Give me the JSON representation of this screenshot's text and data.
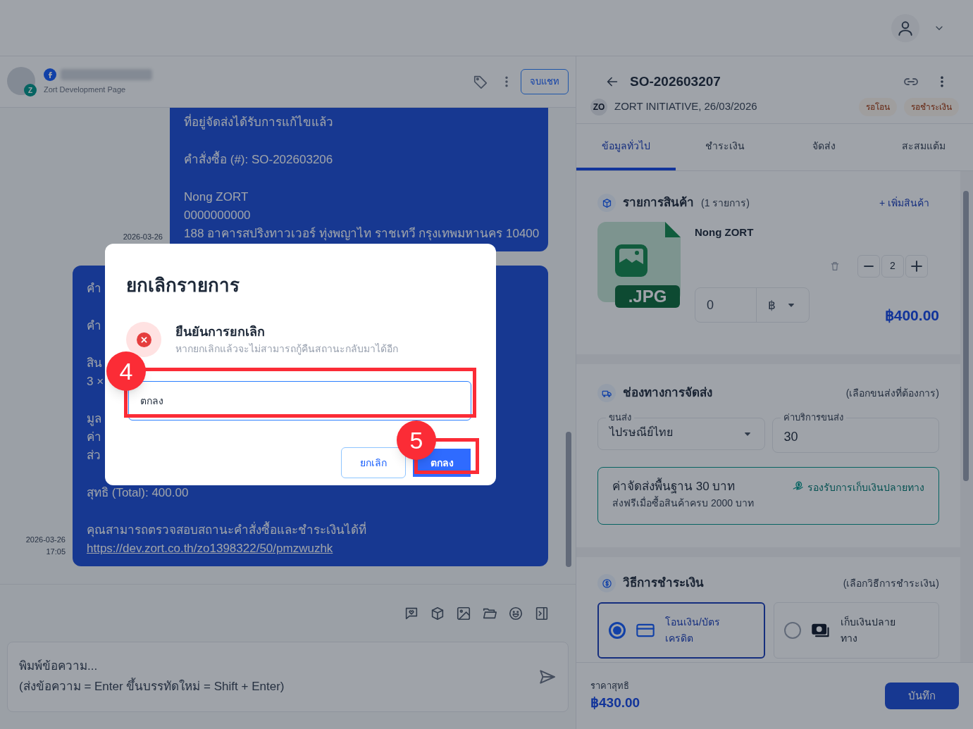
{
  "chat": {
    "header": {
      "page_name": "Zort Development Page",
      "avatar_badge": "Z",
      "end_button": "จบแชท"
    },
    "messages": [
      {
        "time": "2026-03-26",
        "paragraphs": [
          {
            "lines": [
              "ที่อยู่จัดส่งได้รับการแก้ไขแล้ว"
            ]
          },
          {
            "lines": [
              "คำสั่งซื้อ (#): SO-202603206"
            ]
          },
          {
            "lines": [
              "Nong ZORT",
              "0000000000",
              "188 อาคารสปริงทาวเวอร์ ทุ่งพญาไท ราชเทวี กรุงเทพมหานคร 10400"
            ]
          }
        ]
      },
      {
        "time": "2026-03-26 17:05",
        "paragraphs": [
          {
            "lines": [
              "คำ"
            ]
          },
          {
            "lines": [
              "คำ"
            ]
          },
          {
            "lines": [
              "สิน",
              "3 ×"
            ]
          },
          {
            "lines": [
              "มูล",
              "ค่า",
              "ส่ว"
            ]
          },
          {
            "lines": [
              "สุทธิ (Total): 400.00"
            ]
          },
          {
            "lines": [
              "คุณสามารถตรวจสอบสถานะคำสั่งซื้อและชำระเงินได้ที่"
            ],
            "link": "https://dev.zort.co.th/zo1398322/50/pmzwuzhk"
          }
        ]
      }
    ],
    "input": {
      "placeholder": "พิมพ์ข้อความ...\n(ส่งข้อความ = Enter ขึ้นบรรทัดใหม่ = Shift + Enter)"
    }
  },
  "order": {
    "number": "SO-202603207",
    "avatar": "ZO",
    "subtitle": "ZORT INITIATIVE, 26/03/2026",
    "badges": [
      "รอโอน",
      "รอชำระเงิน"
    ],
    "tabs": [
      {
        "label": "ข้อมูลทั่วไป",
        "selected": true
      },
      {
        "label": "ชำระเงิน",
        "selected": false
      },
      {
        "label": "จัดส่ง",
        "selected": false
      },
      {
        "label": "สะสมแต้ม",
        "selected": false
      }
    ],
    "products": {
      "title": "รายการสินค้า",
      "count": "(1 รายการ)",
      "add": "+ เพิ่มสินค้า",
      "items": [
        {
          "file_label": ".JPG",
          "name": "Nong ZORT",
          "quantity": "2",
          "discount": "0",
          "currency": "฿",
          "price": "฿400.00"
        }
      ]
    },
    "shipping": {
      "title": "ช่องทางการจัดส่ง",
      "hint": "(เลือกขนส่งที่ต้องการ)",
      "carrier_label": "ขนส่ง",
      "carrier": "ไปรษณีย์ไทย",
      "fee_label": "ค่าบริการขนส่ง",
      "fee": "30",
      "info_title": "ค่าจัดส่งพื้นฐาน 30 บาท",
      "info_note": "ส่งฟรีเมื่อซื้อสินค้าครบ 2000 บาท",
      "cod": "รองรับการเก็บเงินปลายทาง"
    },
    "payment": {
      "title": "วิธีการชำระเงิน",
      "hint": "(เลือกวิธีการชำระเงิน)",
      "options": [
        {
          "kind": "card",
          "label": "โอนเงิน/บัตรเครดิต",
          "selected": true
        },
        {
          "kind": "cash",
          "label": "เก็บเงินปลายทาง",
          "selected": false
        }
      ]
    },
    "total_label": "ราคาสุทธิ",
    "total": "฿430.00",
    "save": "บันทึก"
  },
  "dialog": {
    "title": "ยกเลิกรายการ",
    "heading": "ยืนยันการยกเลิก",
    "message": "หากยกเลิกแล้วจะไม่สามารถกู้คืนสถานะกลับมาได้อีก",
    "input_value": "ตกลง",
    "cancel": "ยกเลิก",
    "confirm": "ตกลง"
  },
  "annotations": [
    {
      "label": "4"
    },
    {
      "label": "5"
    }
  ]
}
